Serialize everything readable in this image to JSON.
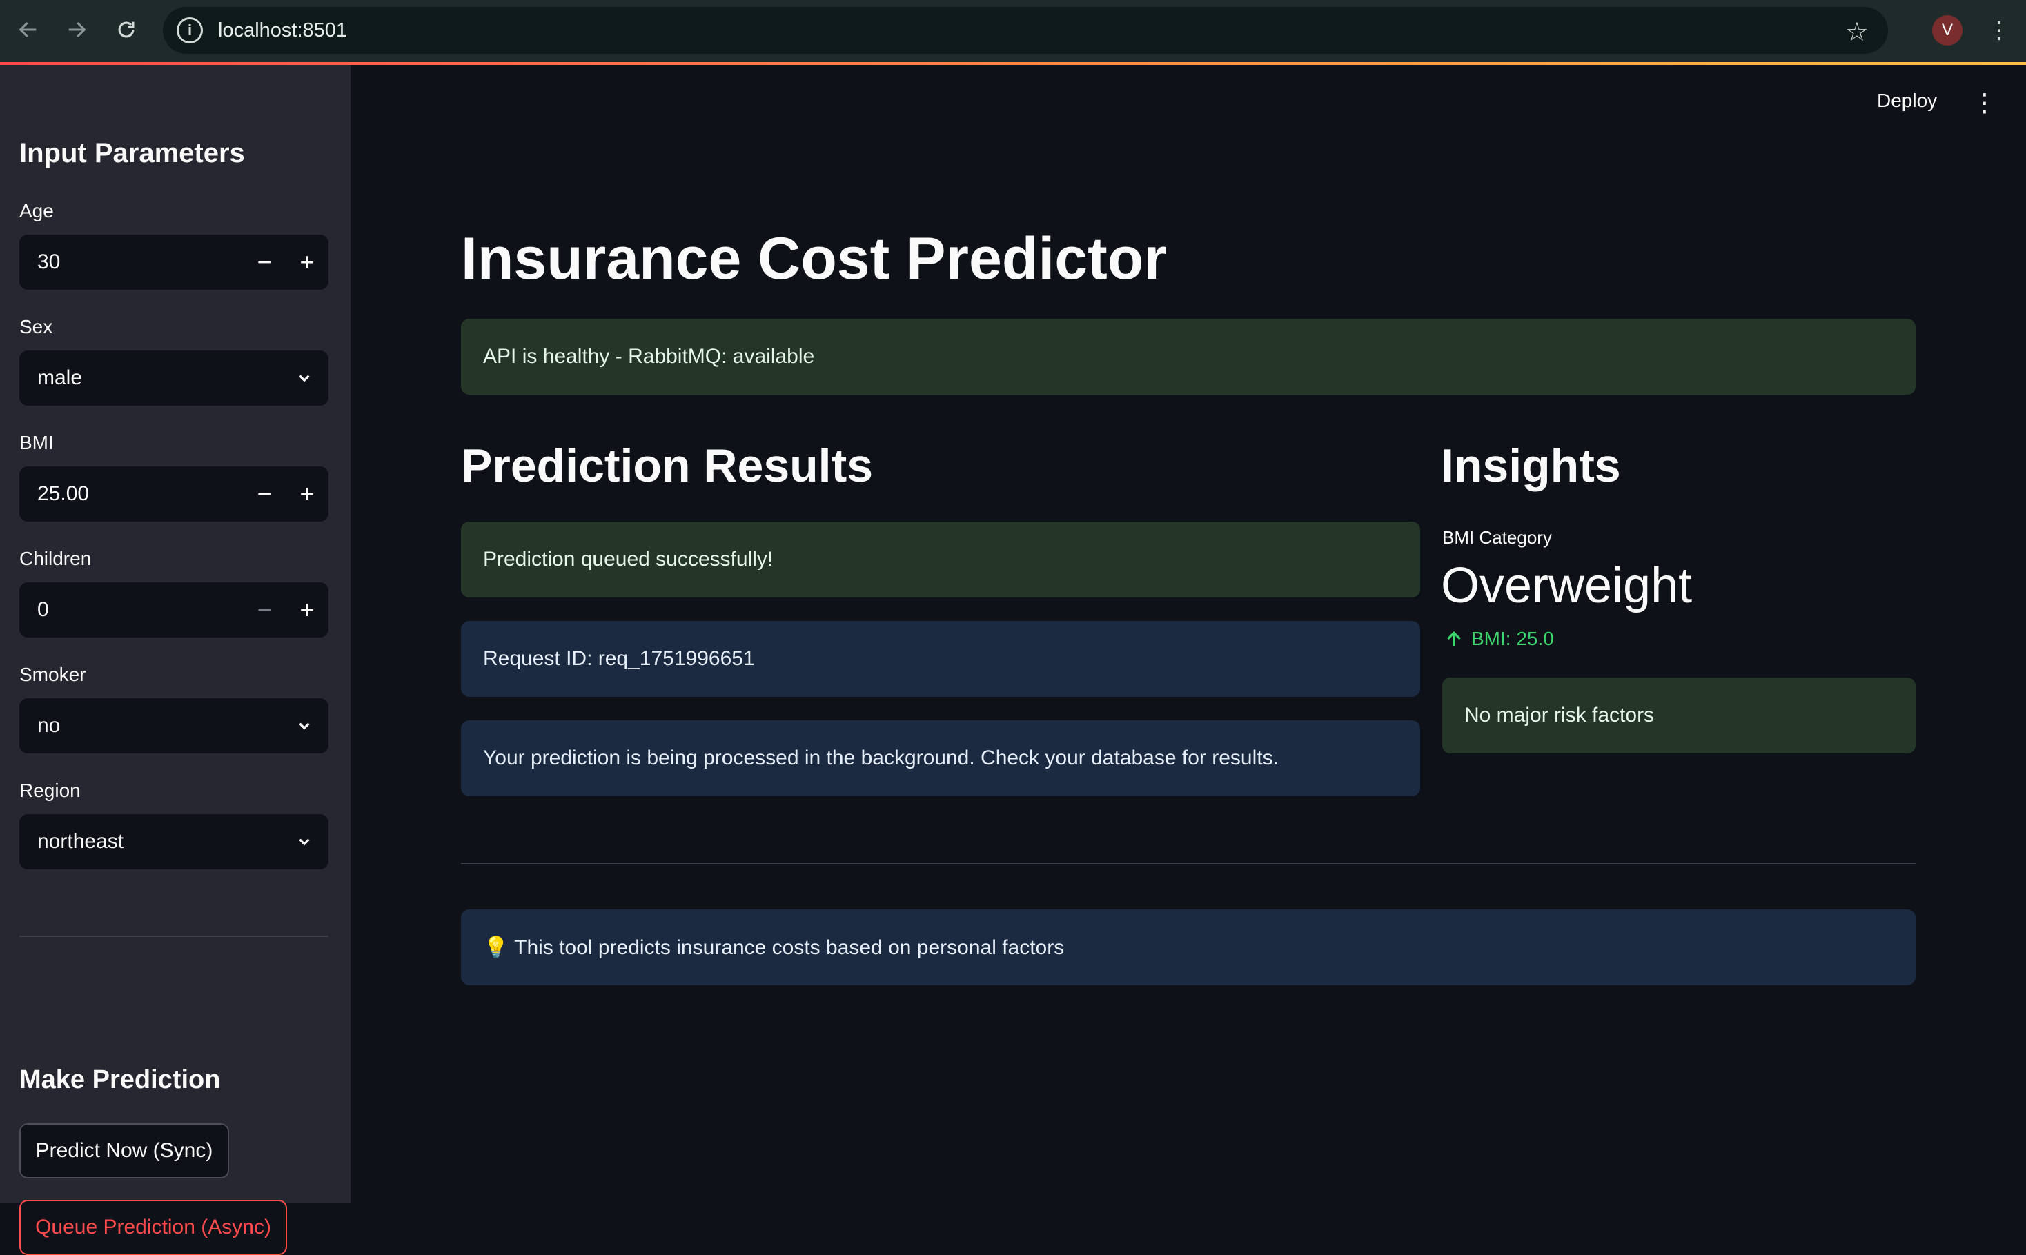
{
  "browser": {
    "url": "localhost:8501",
    "profile_initial": "V",
    "icons": [
      "back-arrow-icon",
      "forward-arrow-icon",
      "reload-icon",
      "site-info-icon",
      "star-icon",
      "kebab-menu-icon"
    ]
  },
  "colors": {
    "primary": "#ff4b4b",
    "success_bg": "#233628",
    "info_bg": "#1b2a40",
    "delta_up": "#3dd56d",
    "sidebar_bg": "#262730",
    "main_bg": "#0e1117"
  },
  "sidebar": {
    "title": "Input Parameters",
    "age": {
      "label": "Age",
      "value": "30"
    },
    "sex": {
      "label": "Sex",
      "value": "male"
    },
    "bmi": {
      "label": "BMI",
      "value": "25.00"
    },
    "children": {
      "label": "Children",
      "value": "0"
    },
    "smoker": {
      "label": "Smoker",
      "value": "no"
    },
    "region": {
      "label": "Region",
      "value": "northeast"
    },
    "stepper_minus": "−",
    "stepper_plus": "+",
    "prediction_title": "Make Prediction",
    "predict_sync_label": "Predict Now (Sync)",
    "queue_async_label": "Queue Prediction (Async)"
  },
  "header": {
    "deploy_label": "Deploy"
  },
  "main": {
    "title": "Insurance Cost Predictor",
    "health_status": "API is healthy - RabbitMQ: available",
    "results_title": "Prediction Results",
    "queued_message": "Prediction queued successfully!",
    "request_id": "Request ID: req_1751996651",
    "processing_message": "Your prediction is being processed in the background. Check your database for results.",
    "insights_title": "Insights",
    "bmi_metric": {
      "label": "BMI Category",
      "value": "Overweight",
      "delta": "BMI: 25.0"
    },
    "risk_message": "No major risk factors",
    "footer_info": "💡 This tool predicts insurance costs based on personal factors"
  }
}
